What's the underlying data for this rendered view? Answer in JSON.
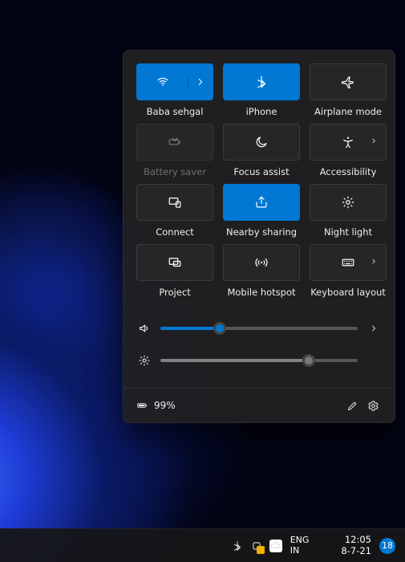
{
  "panel": {
    "tiles": [
      {
        "id": "wifi",
        "label": "Baba sehgal",
        "state": "active",
        "split": true
      },
      {
        "id": "bluetooth",
        "label": "iPhone",
        "state": "active",
        "chevron": false
      },
      {
        "id": "airplane",
        "label": "Airplane mode",
        "state": "off",
        "chevron": false
      },
      {
        "id": "battery-saver",
        "label": "Battery saver",
        "state": "disabled",
        "chevron": false
      },
      {
        "id": "focus-assist",
        "label": "Focus assist",
        "state": "off",
        "chevron": false
      },
      {
        "id": "accessibility",
        "label": "Accessibility",
        "state": "off",
        "chevron": true
      },
      {
        "id": "connect",
        "label": "Connect",
        "state": "off",
        "chevron": false
      },
      {
        "id": "nearby-sharing",
        "label": "Nearby sharing",
        "state": "active",
        "chevron": false
      },
      {
        "id": "night-light",
        "label": "Night light",
        "state": "off",
        "chevron": false
      },
      {
        "id": "project",
        "label": "Project",
        "state": "off",
        "chevron": false
      },
      {
        "id": "mobile-hotspot",
        "label": "Mobile hotspot",
        "state": "off",
        "chevron": false
      },
      {
        "id": "keyboard-layout",
        "label": "Keyboard layout",
        "state": "off",
        "chevron": true
      }
    ],
    "volume_percent": 30,
    "brightness_percent": 75,
    "battery_text": "99%"
  },
  "taskbar": {
    "language_line1": "ENG",
    "language_line2": "IN",
    "time": "12:05",
    "date": "8-7-21",
    "notification_count": "18"
  }
}
